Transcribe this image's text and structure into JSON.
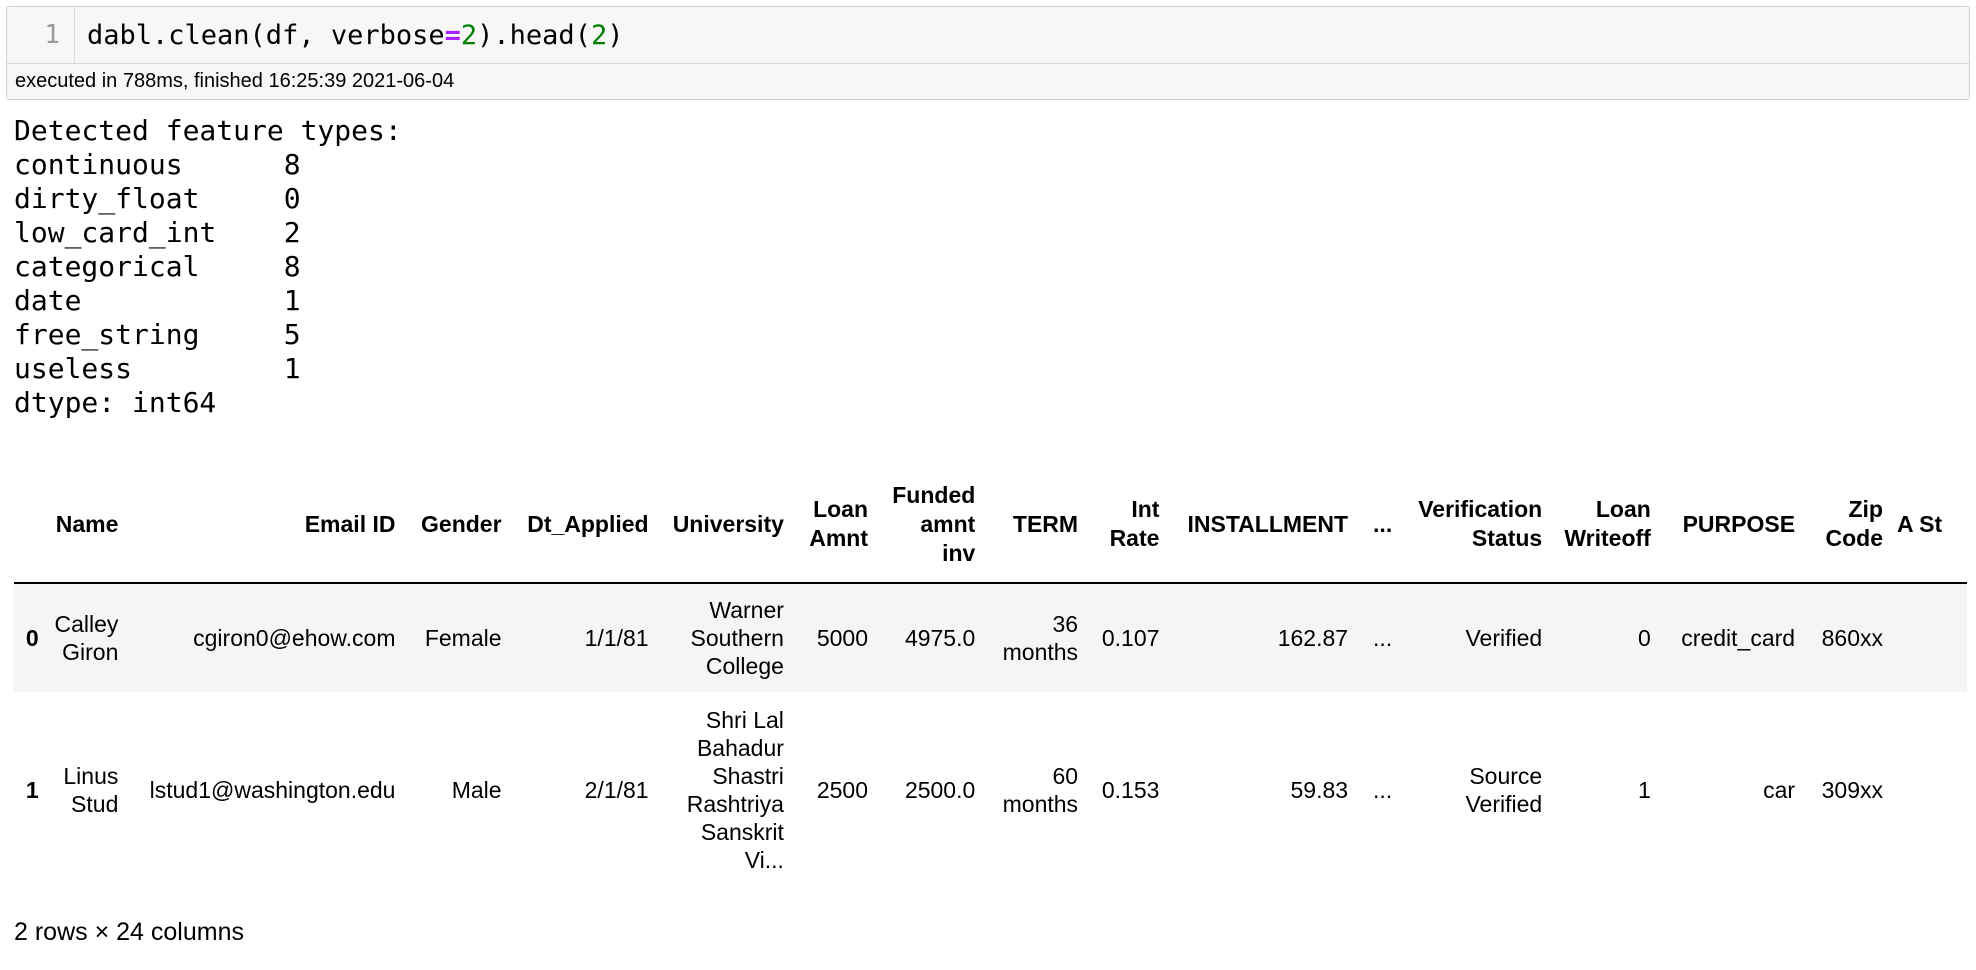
{
  "code_cell": {
    "line_number": "1",
    "code_parts": [
      "dabl.clean(df, verbose",
      "=",
      "2",
      ").head(",
      "2",
      ")"
    ],
    "status": "executed in 788ms, finished 16:25:39 2021-06-04"
  },
  "output_text": "Detected feature types:\ncontinuous      8\ndirty_float     0\nlow_card_int    2\ncategorical     8\ndate            1\nfree_string     5\nuseless         1\ndtype: int64",
  "table": {
    "columns": [
      "",
      "Name",
      "Email ID",
      "Gender",
      "Dt_Applied",
      "University",
      "Loan Amnt",
      "Funded amnt inv",
      "TERM",
      "Int Rate",
      "INSTALLMENT",
      "...",
      "Verification Status",
      "Loan Writeoff",
      "PURPOSE",
      "Zip Code",
      "A St"
    ],
    "rows": [
      [
        "0",
        "Calley Giron",
        "cgiron0@ehow.com",
        "Female",
        "1/1/81",
        "Warner Southern College",
        "5000",
        "4975.0",
        "36 months",
        "0.107",
        "162.87",
        "...",
        "Verified",
        "0",
        "credit_card",
        "860xx",
        ""
      ],
      [
        "1",
        "Linus Stud",
        "lstud1@washington.edu",
        "Male",
        "2/1/81",
        "Shri Lal Bahadur Shastri Rashtriya Sanskrit Vi...",
        "2500",
        "2500.0",
        "60 months",
        "0.153",
        "59.83",
        "...",
        "Source Verified",
        "1",
        "car",
        "309xx",
        ""
      ]
    ],
    "footer": "2 rows × 24 columns"
  }
}
